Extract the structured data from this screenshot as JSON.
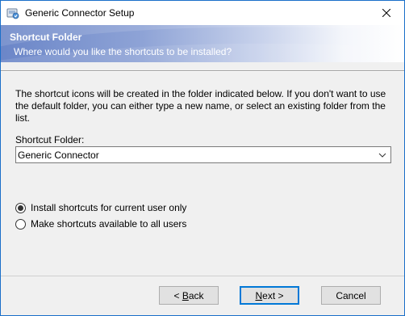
{
  "window": {
    "title": "Generic Connector Setup",
    "icon": "setup-app-icon",
    "close_icon": "close-icon",
    "accent_color": "#1a6fc9"
  },
  "banner": {
    "title": "Shortcut Folder",
    "subtitle": "Where would you like the shortcuts to be installed?"
  },
  "body": {
    "description": "The shortcut icons will be created in the folder indicated below. If you don't want to use the default folder, you can either type a new name, or select an existing folder from the list.",
    "folder_label": "Shortcut Folder:",
    "folder_value": "Generic Connector",
    "options": [
      {
        "label": "Install shortcuts for current user only",
        "checked": true
      },
      {
        "label": "Make shortcuts available to all users",
        "checked": false
      }
    ]
  },
  "buttons": {
    "back": {
      "prefix": "< ",
      "mnemonic": "B",
      "rest": "ack"
    },
    "next": {
      "mnemonic": "N",
      "rest": "ext >"
    },
    "cancel": "Cancel"
  }
}
